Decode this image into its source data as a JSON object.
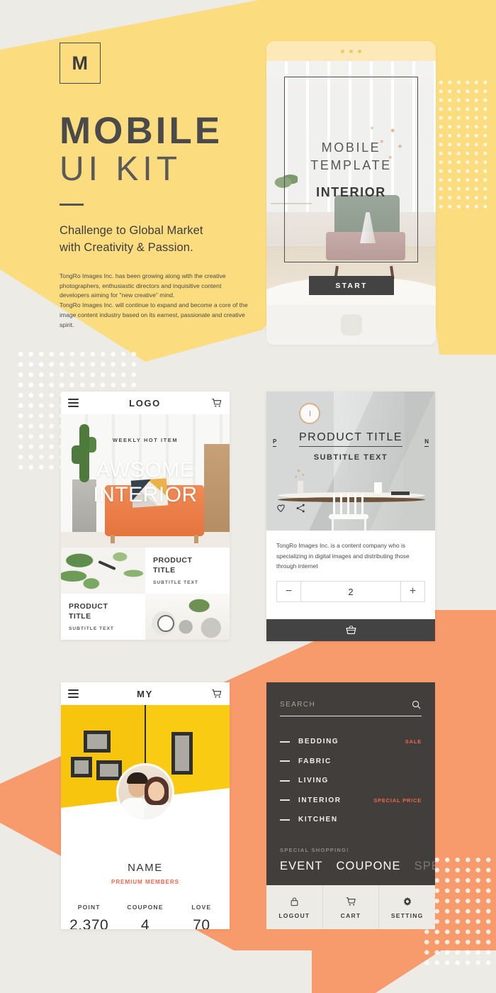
{
  "palette": {
    "background": "#EDEBE6",
    "yellow": "#FBDC7E",
    "orange": "#F89B6C",
    "dark": "#413E3B",
    "accent_red": "#F2664A"
  },
  "hero": {
    "logo_mark": "M",
    "title_main": "MOBILE",
    "title_sub": "UI KIT",
    "tagline_line1": "Challenge to Global Market",
    "tagline_line2": "with Creativity & Passion.",
    "body_copy": "TongRo Images Inc. has been growing along with the creative photographers, enthusiastic directors and inquisitive content developers aiming for \"new creative\" mind.\nTongRo Images Inc. will continue to expand and become a core of the image content industry based on its earnest, passionate and creative spirit."
  },
  "splash": {
    "line1": "MOBILE",
    "line2": "TEMPLATE",
    "line3": "INTERIOR",
    "start_label": "START"
  },
  "home": {
    "appbar_title": "LOGO",
    "banner_kicker": "WEEKLY HOT ITEM",
    "banner_line1": "AWSOME",
    "banner_line2": "INTERIOR",
    "cards": [
      {
        "title": "PRODUCT\nTITLE",
        "subtitle": "SUBTITLE TEXT"
      },
      {
        "title": "PRODUCT\nTITLE",
        "subtitle": "SUBTITLE TEXT"
      }
    ]
  },
  "product": {
    "prev_label": "P",
    "next_label": "N",
    "title": "PRODUCT TITLE",
    "subtitle": "SUBTITLE TEXT",
    "description": "TongRo Images Inc. is a content company who is specializing in digital images and distributing those through internet",
    "qty_minus": "−",
    "qty_value": "2",
    "qty_plus": "+"
  },
  "my": {
    "appbar_title": "MY",
    "name": "NAME",
    "membership": "PREMIUM MEMBERS",
    "stats": [
      {
        "label": "POINT",
        "value": "2,370"
      },
      {
        "label": "COUPONE",
        "value": "4"
      },
      {
        "label": "LOVE",
        "value": "70"
      }
    ]
  },
  "menu": {
    "search_placeholder": "SEARCH",
    "items": [
      {
        "label": "BEDDING",
        "tag": "SALE"
      },
      {
        "label": "FABRIC",
        "tag": ""
      },
      {
        "label": "LIVING",
        "tag": ""
      },
      {
        "label": "INTERIOR",
        "tag": "SPECIAL PRICE"
      },
      {
        "label": "KITCHEN",
        "tag": ""
      }
    ],
    "special_label": "SPECIAL SHOPPING!",
    "special_links": [
      "EVENT",
      "COUPONE",
      "SPE"
    ],
    "tabs": [
      {
        "label": "LOGOUT",
        "icon": "lock-icon"
      },
      {
        "label": "CART",
        "icon": "cart-icon"
      },
      {
        "label": "SETTING",
        "icon": "gear-icon"
      }
    ]
  }
}
